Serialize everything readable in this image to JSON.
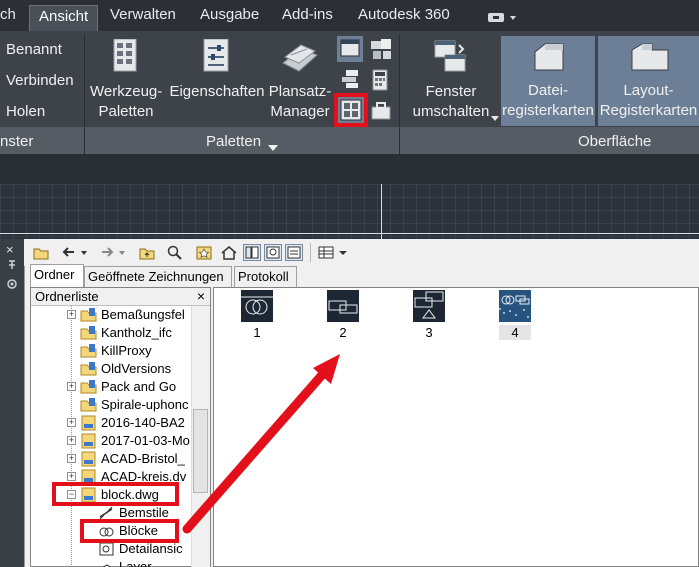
{
  "ribbon": {
    "tabs": [
      {
        "label": "ch"
      },
      {
        "label": "Ansicht",
        "active": true
      },
      {
        "label": "Verwalten"
      },
      {
        "label": "Ausgabe"
      },
      {
        "label": "Add-ins"
      },
      {
        "label": "Autodesk 360"
      }
    ],
    "fenster_panel": {
      "items": [
        "Benannt",
        "Verbinden",
        "Holen"
      ],
      "title": "nster"
    },
    "palette_panel": {
      "werkzeug": [
        "Werkzeug-",
        "Paletten"
      ],
      "eigenschaften": "Eigenschaften",
      "plansatz": [
        "Plansatz-",
        "Manager"
      ],
      "title": "Paletten"
    },
    "oberflaeche_panel": {
      "fenster": [
        "Fenster",
        "umschalten"
      ],
      "datei": [
        "Datei-",
        "registerkarten"
      ],
      "layout": [
        "Layout-",
        "Registerkarten"
      ],
      "title": "Oberfläche"
    }
  },
  "designcenter": {
    "tabs": [
      "Ordner",
      "Geöffnete Zeichnungen",
      "Protokoll"
    ],
    "tree_header": "Ordnerliste",
    "tree_close": "×",
    "tree": [
      {
        "label": "Bemaßungsfel",
        "expander": "+"
      },
      {
        "label": "Kantholz_ifc",
        "expander": ""
      },
      {
        "label": "KillProxy",
        "expander": ""
      },
      {
        "label": "OldVersions",
        "expander": ""
      },
      {
        "label": "Pack and Go",
        "expander": "+"
      },
      {
        "label": "Spirale-uphonc",
        "expander": ""
      },
      {
        "label": "2016-140-BA2",
        "expander": "+"
      },
      {
        "label": "2017-01-03-Mo",
        "expander": "+"
      },
      {
        "label": "ACAD-Bristol_",
        "expander": "+"
      },
      {
        "label": "ACAD-kreis.dv",
        "expander": "+"
      },
      {
        "label": "block.dwg",
        "expander": "−"
      },
      {
        "label": "Bemstile",
        "expander": ""
      },
      {
        "label": "Blöcke",
        "expander": ""
      },
      {
        "label": "Detailansic",
        "expander": ""
      },
      {
        "label": "Layer",
        "expander": ""
      }
    ],
    "blocks": [
      "1",
      "2",
      "3",
      "4"
    ]
  },
  "colors": {
    "highlight": "#e3101c",
    "ribbon_dark": "#3e434a",
    "selected_button": "#6d7f97"
  }
}
